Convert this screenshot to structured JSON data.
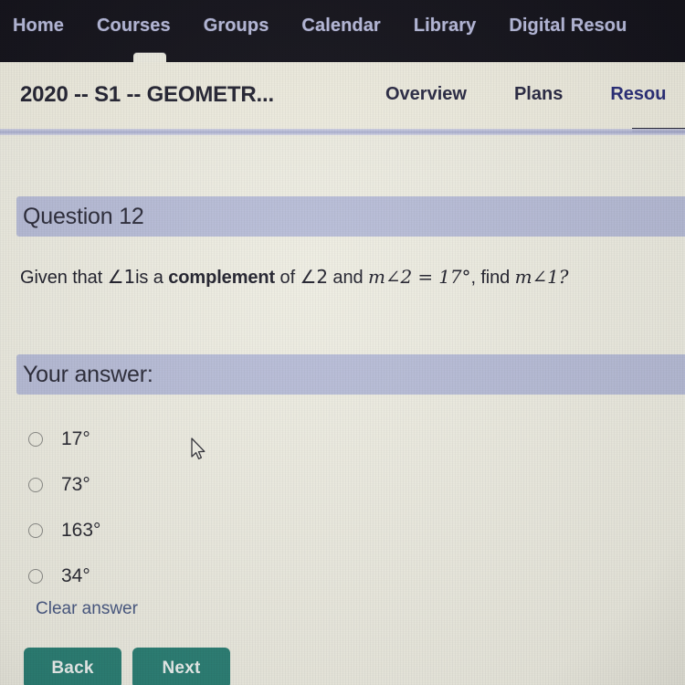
{
  "topnav": {
    "items": [
      {
        "label": "Home"
      },
      {
        "label": "Courses"
      },
      {
        "label": "Groups"
      },
      {
        "label": "Calendar"
      },
      {
        "label": "Library"
      },
      {
        "label": "Digital Resou"
      }
    ]
  },
  "coursebar": {
    "title": "2020 -- S1 -- GEOMETR...",
    "tabs": [
      {
        "label": "Overview",
        "active": false
      },
      {
        "label": "Plans",
        "active": false
      },
      {
        "label": "Resou",
        "active": true
      }
    ]
  },
  "question": {
    "banner_label": "Question 12",
    "prompt_parts": {
      "lead": "Given that ",
      "angle1": "∠1",
      "mid1": "is a ",
      "bold": "complement",
      "mid2": " of ",
      "angle2": "∠2",
      "mid3": " and ",
      "measure": "m∠2 = 17°",
      "mid4": ", find ",
      "measure2": "m∠1?"
    },
    "prompt_plain": "Given that ∠1 is a complement of ∠2 and m∠2 = 17°, find m∠1?"
  },
  "answer": {
    "banner_label": "Your answer:",
    "options": [
      {
        "label": "17°",
        "selected": false
      },
      {
        "label": "73°",
        "selected": false
      },
      {
        "label": "163°",
        "selected": false
      },
      {
        "label": "34°",
        "selected": false
      }
    ],
    "clear_label": "Clear answer"
  },
  "buttons": {
    "back_label": "Back",
    "next_label": "Next"
  },
  "colors": {
    "topnav_bg": "#15141c",
    "topnav_text": "#b9bcdd",
    "coursebar_bg": "#f0eee1",
    "page_bg": "#efeee3",
    "banner_bg": "#b9bed9",
    "button_teal": "#2d8176",
    "link_blue": "#4a5a84",
    "active_tab": "#2b2f7a"
  }
}
